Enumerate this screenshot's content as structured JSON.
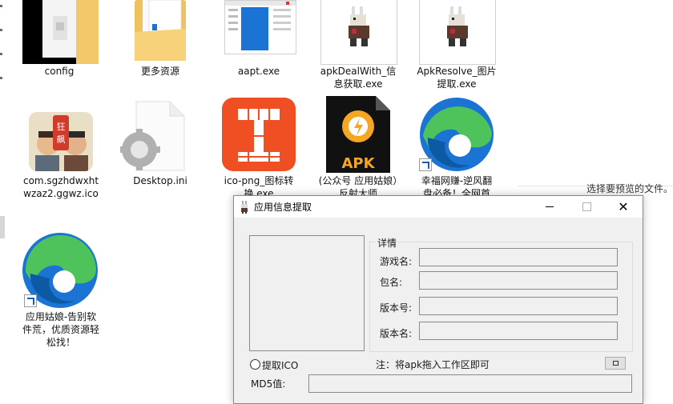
{
  "desktop": {
    "icons": [
      {
        "name": "config",
        "type": "folder"
      },
      {
        "name": "更多资源",
        "type": "folder"
      },
      {
        "name": "aapt.exe",
        "type": "exe"
      },
      {
        "name": "apkDealWith_信息获取.exe",
        "type": "exe"
      },
      {
        "name": "ApkResolve_图片提取.exe",
        "type": "exe"
      },
      {
        "name": "com.sgzhdwxhtwzaz2.ggwz.ico",
        "type": "ico"
      },
      {
        "name": "Desktop.ini",
        "type": "ini"
      },
      {
        "name": "ico-png_图标转换.exe",
        "type": "exe"
      },
      {
        "name": "(公众号 应用姑娘）反射大师",
        "type": "apk"
      },
      {
        "name": "幸福网赚-逆风翻盘必备！全网首",
        "type": "shortcut"
      },
      {
        "name": "应用姑娘-告别软件荒，优质资源轻松找！",
        "type": "shortcut"
      }
    ],
    "apk_badge": "APK",
    "game_badge": "狂飙",
    "preview_text": "选择要预览的文件。"
  },
  "dialog": {
    "title": "应用信息提取",
    "group_title": "详情",
    "fields": [
      {
        "label": "游戏名:",
        "value": ""
      },
      {
        "label": "包名:",
        "value": ""
      },
      {
        "label": "版本号:",
        "value": ""
      },
      {
        "label": "版本名:",
        "value": ""
      }
    ],
    "radio_label": "提取ICO",
    "note": "注：将apk拖入工作区即可",
    "md5_label": "MD5值:",
    "md5_value": ""
  },
  "colors": {
    "folder": "#f3c86a",
    "ico_tool": "#f04e23",
    "edge_blue": "#1b74d3",
    "edge_green": "#4fc35b",
    "dialog_bg": "#f0f0f0"
  }
}
